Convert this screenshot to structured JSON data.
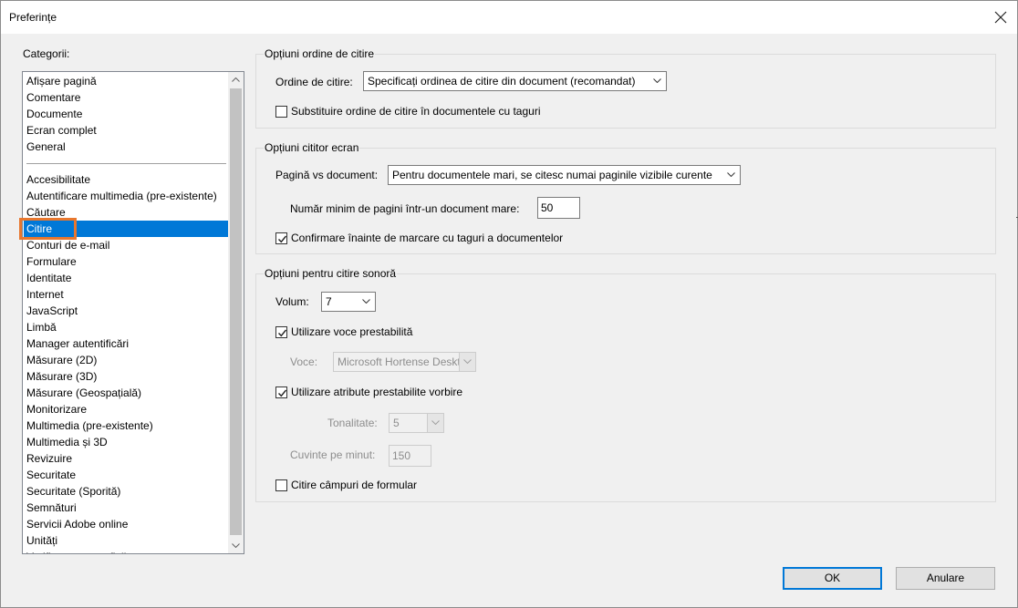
{
  "window": {
    "title": "Preferințe"
  },
  "categories": {
    "label": "Categorii:",
    "group1": [
      "Afișare pagină",
      "Comentare",
      "Documente",
      "Ecran complet",
      "General"
    ],
    "group2": [
      "Accesibilitate",
      "Autentificare multimedia (pre-existente)",
      "Căutare",
      "Citire",
      "Conturi de e-mail",
      "Formulare",
      "Identitate",
      "Internet",
      "JavaScript",
      "Limbă",
      "Manager autentificări",
      "Măsurare (2D)",
      "Măsurare (3D)",
      "Măsurare (Geospațială)",
      "Monitorizare",
      "Multimedia (pre-existente)",
      "Multimedia și 3D",
      "Revizuire",
      "Securitate",
      "Securitate (Sporită)",
      "Semnături",
      "Servicii Adobe online",
      "Unități",
      "Verificare ortografică"
    ],
    "selected": "Citire"
  },
  "reading_order": {
    "group_title": "Opțiuni ordine de citire",
    "order_label": "Ordine de citire:",
    "order_value": "Specificați ordinea de citire din document (recomandat)",
    "override_label": "Substituire ordine de citire în documentele cu taguri",
    "override_checked": false
  },
  "screen_reader": {
    "group_title": "Opțiuni cititor ecran",
    "page_vs_doc_label": "Pagină vs document:",
    "page_vs_doc_value": "Pentru documentele mari, se citesc numai paginile vizibile curente",
    "min_pages_label": "Număr minim de pagini într-un document mare:",
    "min_pages_value": "50",
    "confirm_label": "Confirmare înainte de marcare cu taguri a documentelor",
    "confirm_checked": true
  },
  "read_aloud": {
    "group_title": "Opțiuni pentru citire sonoră",
    "volume_label": "Volum:",
    "volume_value": "7",
    "default_voice_label": "Utilizare voce prestabilită",
    "default_voice_checked": true,
    "voice_label": "Voce:",
    "voice_value": "Microsoft Hortense Desktop",
    "default_speech_label": "Utilizare atribute prestabilite vorbire",
    "default_speech_checked": true,
    "pitch_label": "Tonalitate:",
    "pitch_value": "5",
    "wpm_label": "Cuvinte pe minut:",
    "wpm_value": "150",
    "form_fields_label": "Citire câmpuri de formular",
    "form_fields_checked": false
  },
  "buttons": {
    "ok": "OK",
    "cancel": "Anulare"
  }
}
